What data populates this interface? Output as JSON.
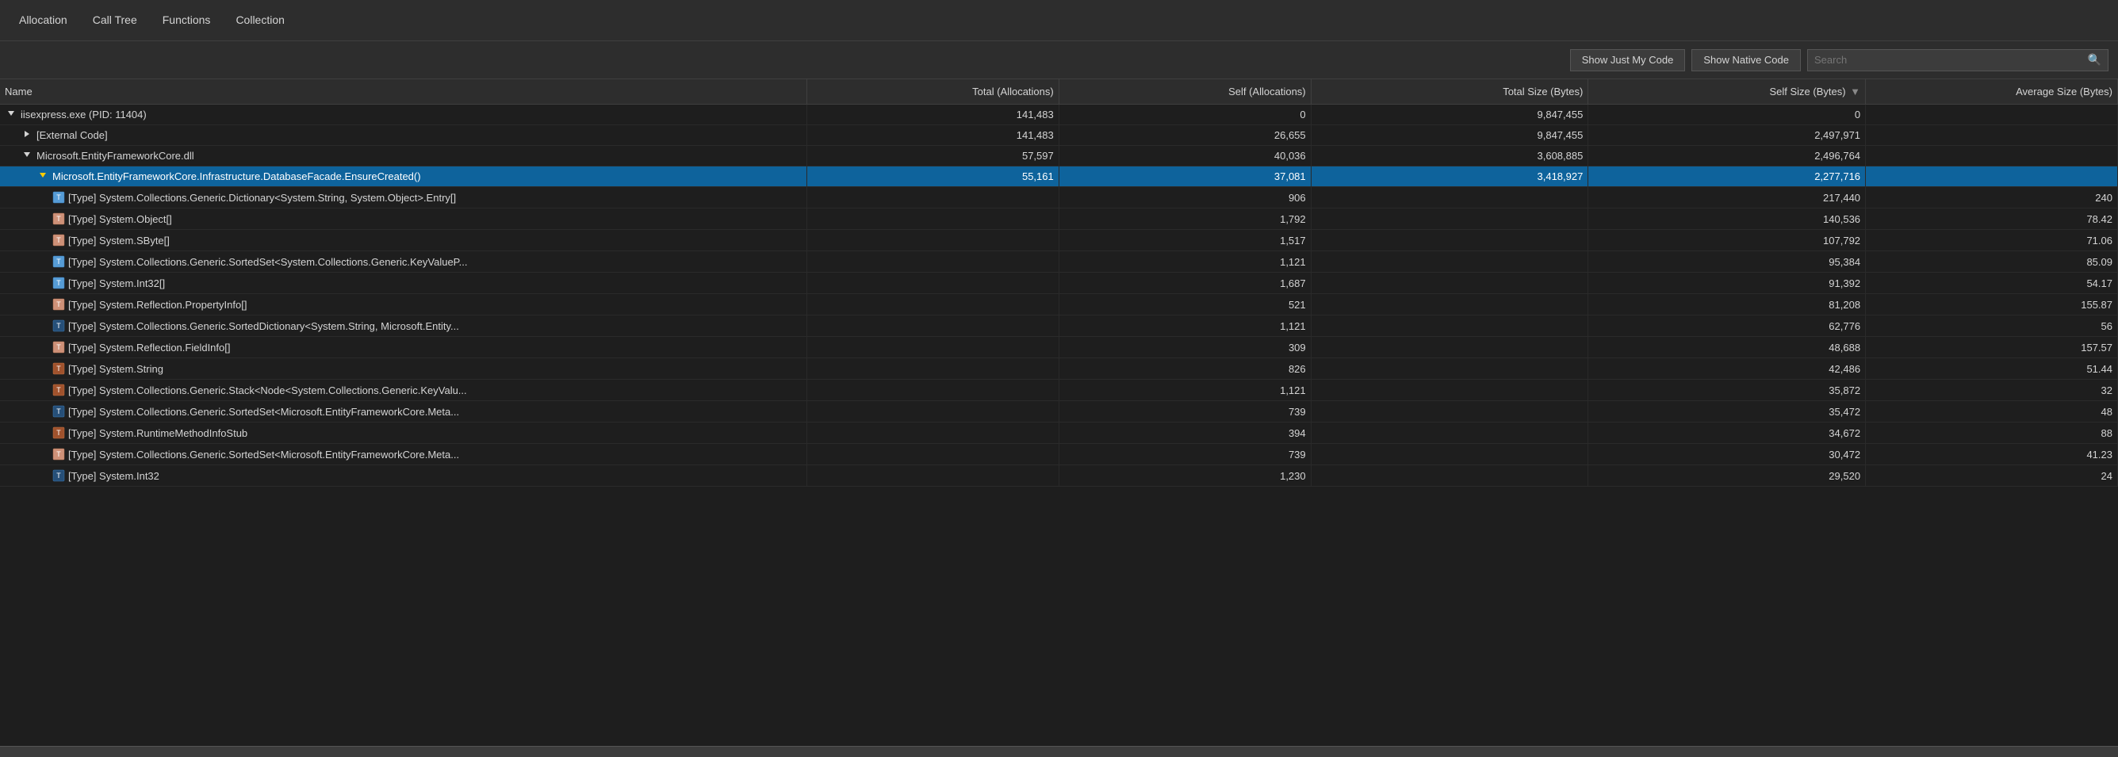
{
  "nav": {
    "items": [
      {
        "id": "allocation",
        "label": "Allocation"
      },
      {
        "id": "call-tree",
        "label": "Call Tree"
      },
      {
        "id": "functions",
        "label": "Functions"
      },
      {
        "id": "collection",
        "label": "Collection"
      }
    ]
  },
  "toolbar": {
    "show_just_my_code_label": "Show Just My Code",
    "show_native_code_label": "Show Native Code",
    "search_placeholder": "Search"
  },
  "table": {
    "columns": [
      {
        "id": "name",
        "label": "Name"
      },
      {
        "id": "total-alloc",
        "label": "Total (Allocations)"
      },
      {
        "id": "self-alloc",
        "label": "Self (Allocations)"
      },
      {
        "id": "total-size",
        "label": "Total Size (Bytes)"
      },
      {
        "id": "self-size",
        "label": "Self Size (Bytes)"
      },
      {
        "id": "avg-size",
        "label": "Average Size (Bytes)"
      }
    ],
    "rows": [
      {
        "id": "row-iisexpress",
        "indent": 0,
        "expand": "collapse",
        "icon": "arrow-down",
        "name": "iisexpress.exe (PID: 11404)",
        "totalAlloc": "141,483",
        "selfAlloc": "0",
        "totalSize": "9,847,455",
        "selfSize": "0",
        "avgSize": "",
        "selected": false
      },
      {
        "id": "row-external",
        "indent": 1,
        "expand": "expand",
        "icon": "arrow-right",
        "name": "[External Code]",
        "totalAlloc": "141,483",
        "selfAlloc": "26,655",
        "totalSize": "9,847,455",
        "selfSize": "2,497,971",
        "avgSize": "",
        "selected": false
      },
      {
        "id": "row-ef",
        "indent": 1,
        "expand": "collapse",
        "icon": "arrow-down",
        "name": "Microsoft.EntityFrameworkCore.dll",
        "totalAlloc": "57,597",
        "selfAlloc": "40,036",
        "totalSize": "3,608,885",
        "selfSize": "2,496,764",
        "avgSize": "",
        "selected": false
      },
      {
        "id": "row-ensure",
        "indent": 2,
        "expand": "collapse-warn",
        "icon": "arrow-down-warn",
        "name": "Microsoft.EntityFrameworkCore.Infrastructure.DatabaseFacade.EnsureCreated()",
        "totalAlloc": "55,161",
        "selfAlloc": "37,081",
        "totalSize": "3,418,927",
        "selfSize": "2,277,716",
        "avgSize": "",
        "selected": true
      },
      {
        "id": "row-dict",
        "indent": 3,
        "icon": "type-blue",
        "name": "[Type] System.Collections.Generic.Dictionary<System.String, System.Object>.Entry[]",
        "totalAlloc": "",
        "selfAlloc": "906",
        "totalSize": "",
        "selfSize": "217,440",
        "avgSize": "240",
        "selected": false
      },
      {
        "id": "row-obj-arr",
        "indent": 3,
        "icon": "type-orange",
        "name": "[Type] System.Object[]",
        "totalAlloc": "",
        "selfAlloc": "1,792",
        "totalSize": "",
        "selfSize": "140,536",
        "avgSize": "78.42",
        "selected": false
      },
      {
        "id": "row-sbyte",
        "indent": 3,
        "icon": "type-orange",
        "name": "[Type] System.SByte[]",
        "totalAlloc": "",
        "selfAlloc": "1,517",
        "totalSize": "",
        "selfSize": "107,792",
        "avgSize": "71.06",
        "selected": false
      },
      {
        "id": "row-sorted-set",
        "indent": 3,
        "icon": "type-blue",
        "name": "[Type] System.Collections.Generic.SortedSet<System.Collections.Generic.KeyValueP...",
        "totalAlloc": "",
        "selfAlloc": "1,121",
        "totalSize": "",
        "selfSize": "95,384",
        "avgSize": "85.09",
        "selected": false
      },
      {
        "id": "row-int32",
        "indent": 3,
        "icon": "type-blue",
        "name": "[Type] System.Int32[]",
        "totalAlloc": "",
        "selfAlloc": "1,687",
        "totalSize": "",
        "selfSize": "91,392",
        "avgSize": "54.17",
        "selected": false
      },
      {
        "id": "row-propinfo",
        "indent": 3,
        "icon": "type-orange",
        "name": "[Type] System.Reflection.PropertyInfo[]",
        "totalAlloc": "",
        "selfAlloc": "521",
        "totalSize": "",
        "selfSize": "81,208",
        "avgSize": "155.87",
        "selected": false
      },
      {
        "id": "row-sorted-dict",
        "indent": 3,
        "icon": "type-blue-dark",
        "name": "[Type] System.Collections.Generic.SortedDictionary<System.String, Microsoft.Entity...",
        "totalAlloc": "",
        "selfAlloc": "1,121",
        "totalSize": "",
        "selfSize": "62,776",
        "avgSize": "56",
        "selected": false
      },
      {
        "id": "row-fieldinfo",
        "indent": 3,
        "icon": "type-orange",
        "name": "[Type] System.Reflection.FieldInfo[]",
        "totalAlloc": "",
        "selfAlloc": "309",
        "totalSize": "",
        "selfSize": "48,688",
        "avgSize": "157.57",
        "selected": false
      },
      {
        "id": "row-string",
        "indent": 3,
        "icon": "type-orange-dark",
        "name": "[Type] System.String",
        "totalAlloc": "",
        "selfAlloc": "826",
        "totalSize": "",
        "selfSize": "42,486",
        "avgSize": "51.44",
        "selected": false
      },
      {
        "id": "row-stack",
        "indent": 3,
        "icon": "type-orange-dark",
        "name": "[Type] System.Collections.Generic.Stack<Node<System.Collections.Generic.KeyValu...",
        "totalAlloc": "",
        "selfAlloc": "1,121",
        "totalSize": "",
        "selfSize": "35,872",
        "avgSize": "32",
        "selected": false
      },
      {
        "id": "row-sorted-set2",
        "indent": 3,
        "icon": "type-blue-dark",
        "name": "[Type] System.Collections.Generic.SortedSet<Microsoft.EntityFrameworkCore.Meta...",
        "totalAlloc": "",
        "selfAlloc": "739",
        "totalSize": "",
        "selfSize": "35,472",
        "avgSize": "48",
        "selected": false
      },
      {
        "id": "row-runtime",
        "indent": 3,
        "icon": "type-orange-dark",
        "name": "[Type] System.RuntimeMethodInfoStub",
        "totalAlloc": "",
        "selfAlloc": "394",
        "totalSize": "",
        "selfSize": "34,672",
        "avgSize": "88",
        "selected": false
      },
      {
        "id": "row-sorted-set3",
        "indent": 3,
        "icon": "type-orange",
        "name": "[Type] System.Collections.Generic.SortedSet<Microsoft.EntityFrameworkCore.Meta...",
        "totalAlloc": "",
        "selfAlloc": "739",
        "totalSize": "",
        "selfSize": "30,472",
        "avgSize": "41.23",
        "selected": false
      },
      {
        "id": "row-int32-2",
        "indent": 3,
        "icon": "type-blue-dark",
        "name": "[Type] System.Int32",
        "totalAlloc": "",
        "selfAlloc": "1,230",
        "totalSize": "",
        "selfSize": "29,520",
        "avgSize": "24",
        "selected": false
      }
    ]
  }
}
